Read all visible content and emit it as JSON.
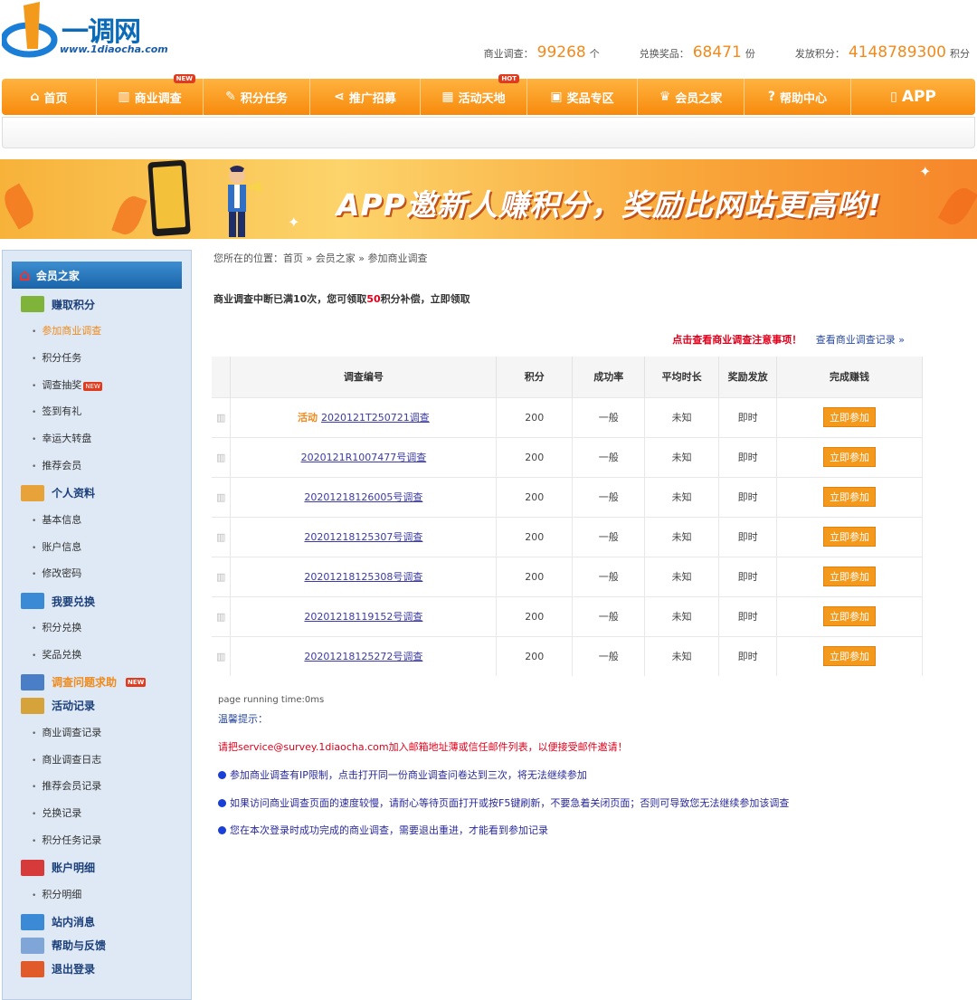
{
  "header": {
    "brand": "一调网",
    "url": "www.1diaocha.com",
    "stats": [
      {
        "label": "商业调查：",
        "value": "99268",
        "unit": "个"
      },
      {
        "label": "兑换奖品：",
        "value": "68471",
        "unit": "份"
      },
      {
        "label": "发放积分：",
        "value": "4148789300",
        "unit": "积分"
      }
    ]
  },
  "nav": [
    {
      "label": "首页",
      "icon": "home-icon",
      "badge": ""
    },
    {
      "label": "商业调查",
      "icon": "chart-icon",
      "badge": "NEW"
    },
    {
      "label": "积分任务",
      "icon": "task-icon",
      "badge": ""
    },
    {
      "label": "推广招募",
      "icon": "share-icon",
      "badge": ""
    },
    {
      "label": "活动天地",
      "icon": "building-icon",
      "badge": "HOT"
    },
    {
      "label": "奖品专区",
      "icon": "gift-icon",
      "badge": ""
    },
    {
      "label": "会员之家",
      "icon": "crown-icon",
      "badge": ""
    },
    {
      "label": "帮助中心",
      "icon": "help-icon",
      "badge": ""
    },
    {
      "label": "APP",
      "icon": "phone-icon",
      "badge": ""
    }
  ],
  "banner": {
    "text": "APP邀新人赚积分，奖励比网站更高哟!"
  },
  "sidebar": {
    "home": "会员之家",
    "sections": [
      {
        "title": "赚取积分",
        "color": "#7fb33a",
        "links": [
          {
            "label": "参加商业调查",
            "active": true,
            "new": false
          },
          {
            "label": "积分任务",
            "active": false,
            "new": false
          },
          {
            "label": "调查抽奖",
            "active": false,
            "new": true
          },
          {
            "label": "签到有礼",
            "active": false,
            "new": false
          },
          {
            "label": "幸运大转盘",
            "active": false,
            "new": false
          },
          {
            "label": "推荐会员",
            "active": false,
            "new": false
          }
        ]
      },
      {
        "title": "个人资料",
        "color": "#e8a23a",
        "links": [
          {
            "label": "基本信息",
            "active": false,
            "new": false
          },
          {
            "label": "账户信息",
            "active": false,
            "new": false
          },
          {
            "label": "修改密码",
            "active": false,
            "new": false
          }
        ]
      },
      {
        "title": "我要兑换",
        "color": "#3a8ad6",
        "links": [
          {
            "label": "积分兑换",
            "active": false,
            "new": false
          },
          {
            "label": "奖品兑换",
            "active": false,
            "new": false
          }
        ]
      },
      {
        "title": "调查问题求助",
        "color": "#4a7fc8",
        "new": true,
        "orange": true,
        "links": []
      },
      {
        "title": "活动记录",
        "color": "#d6a23a",
        "links": [
          {
            "label": "商业调查记录",
            "active": false,
            "new": false
          },
          {
            "label": "商业调查日志",
            "active": false,
            "new": false
          },
          {
            "label": "推荐会员记录",
            "active": false,
            "new": false
          },
          {
            "label": "兑换记录",
            "active": false,
            "new": false
          },
          {
            "label": "积分任务记录",
            "active": false,
            "new": false
          }
        ]
      },
      {
        "title": "账户明细",
        "color": "#d63a3a",
        "links": [
          {
            "label": "积分明细",
            "active": false,
            "new": false
          }
        ]
      },
      {
        "title": "站内消息",
        "color": "#3a8ad6",
        "links": []
      },
      {
        "title": "帮助与反馈",
        "color": "#7fa6d6",
        "links": []
      },
      {
        "title": "退出登录",
        "color": "#e05a2a",
        "links": []
      }
    ],
    "new_badge": "NEW"
  },
  "main": {
    "breadcrumb": "您所在的位置：首页 » 会员之家 » 参加商业调查",
    "notice_a": "商业调查中断已满10次，您可领取",
    "notice_num": "50",
    "notice_b": "积分补偿，立即领取",
    "link_rules": "点击查看商业调查注意事项！",
    "link_records": "查看商业调查记录 »",
    "headers": [
      "调查编号",
      "积分",
      "成功率",
      "平均时长",
      "奖励发放",
      "完成赚钱"
    ],
    "rows": [
      {
        "tag": "活动",
        "id": "2020121T250721调查",
        "points": "200",
        "rate": "一般",
        "time": "未知",
        "reward": "即时",
        "btn": "立即参加"
      },
      {
        "tag": "",
        "id": "2020121R1007477号调查",
        "points": "200",
        "rate": "一般",
        "time": "未知",
        "reward": "即时",
        "btn": "立即参加"
      },
      {
        "tag": "",
        "id": "20201218126005号调查",
        "points": "200",
        "rate": "一般",
        "time": "未知",
        "reward": "即时",
        "btn": "立即参加"
      },
      {
        "tag": "",
        "id": "20201218125307号调查",
        "points": "200",
        "rate": "一般",
        "time": "未知",
        "reward": "即时",
        "btn": "立即参加"
      },
      {
        "tag": "",
        "id": "20201218125308号调查",
        "points": "200",
        "rate": "一般",
        "time": "未知",
        "reward": "即时",
        "btn": "立即参加"
      },
      {
        "tag": "",
        "id": "20201218119152号调查",
        "points": "200",
        "rate": "一般",
        "time": "未知",
        "reward": "即时",
        "btn": "立即参加"
      },
      {
        "tag": "",
        "id": "20201218125272号调查",
        "points": "200",
        "rate": "一般",
        "time": "未知",
        "reward": "即时",
        "btn": "立即参加"
      }
    ],
    "runtime": "page running time:0ms",
    "tips_title": "温馨提示：",
    "tip_red": "请把service@survey.1diaocha.com加入邮箱地址薄或信任邮件列表，以便接受邮件邀请！",
    "tips": [
      "参加商业调查有IP限制，点击打开同一份商业调查问卷达到三次，将无法继续参加",
      "如果访问商业调查页面的速度较慢，请耐心等待页面打开或按F5键刷新，不要急着关闭页面；否则可导致您无法继续参加该调查",
      "您在本次登录时成功完成的商业调查，需要退出重进，才能看到参加记录"
    ]
  }
}
